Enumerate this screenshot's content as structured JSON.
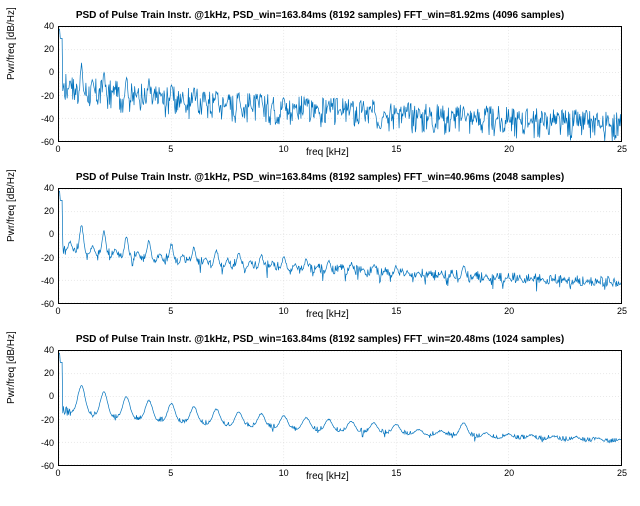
{
  "chart_data": [
    {
      "type": "line",
      "title": "PSD of Pulse Train Instr. @1kHz, PSD_win=163.84ms (8192 samples) FFT_win=81.92ms (4096 samples)",
      "xlabel": "freq [kHz]",
      "ylabel": "Pwr/freq [dB/Hz]",
      "xlim": [
        0,
        25
      ],
      "ylim": [
        -60,
        40
      ],
      "xticks": [
        0,
        5,
        10,
        15,
        20,
        25
      ],
      "yticks": [
        -60,
        -40,
        -20,
        0,
        20,
        40
      ],
      "series": [
        {
          "name": "PSD",
          "description": "Harmonic peaks at ~1 kHz spacing. First few harmonics around 0 to 20 dB/Hz, decaying trend line from roughly -10 dB/Hz near DC down to ~-45 dB/Hz by 25 kHz. Noise floor sits around -50 to -55 dB/Hz with occasional dips to -60. Strong peaks at low kHz (1,2,3 kHz) around +20 dB/Hz."
        }
      ]
    },
    {
      "type": "line",
      "title": "PSD of Pulse Train Instr. @1kHz, PSD_win=163.84ms (8192 samples) FFT_win=40.96ms (2048 samples)",
      "xlabel": "freq [kHz]",
      "ylabel": "Pwr/freq [dB/Hz]",
      "xlim": [
        0,
        25
      ],
      "ylim": [
        -60,
        40
      ],
      "xticks": [
        0,
        5,
        10,
        15,
        20,
        25
      ],
      "yticks": [
        -60,
        -40,
        -20,
        0,
        20,
        40
      ],
      "series": [
        {
          "name": "PSD",
          "description": "Smoother than first plot. 1 kHz harmonics visible up to ~20 kHz. Early peaks around +10 to +20 dB/Hz, trend line decays from ~-10 to ~-45 dB/Hz. Noise floor ~-45 to -50 dB/Hz."
        }
      ]
    },
    {
      "type": "line",
      "title": "PSD of Pulse Train Instr. @1kHz, PSD_win=163.84ms (8192 samples) FFT_win=20.48ms (1024 samples)",
      "xlabel": "freq [kHz]",
      "ylabel": "Pwr/freq [dB/Hz]",
      "xlim": [
        0,
        25
      ],
      "ylim": [
        -60,
        40
      ],
      "xticks": [
        0,
        5,
        10,
        15,
        20,
        25
      ],
      "yticks": [
        -60,
        -40,
        -20,
        0,
        20,
        40
      ],
      "series": [
        {
          "name": "PSD",
          "description": "Smoothest of the three. Broad 1 kHz harmonic bumps. Early peaks around 0 to +20 dB/Hz, trend line decays from ~-10 to ~-40 dB/Hz. Noise floor ~-40 to -45 dB/Hz."
        }
      ]
    }
  ]
}
